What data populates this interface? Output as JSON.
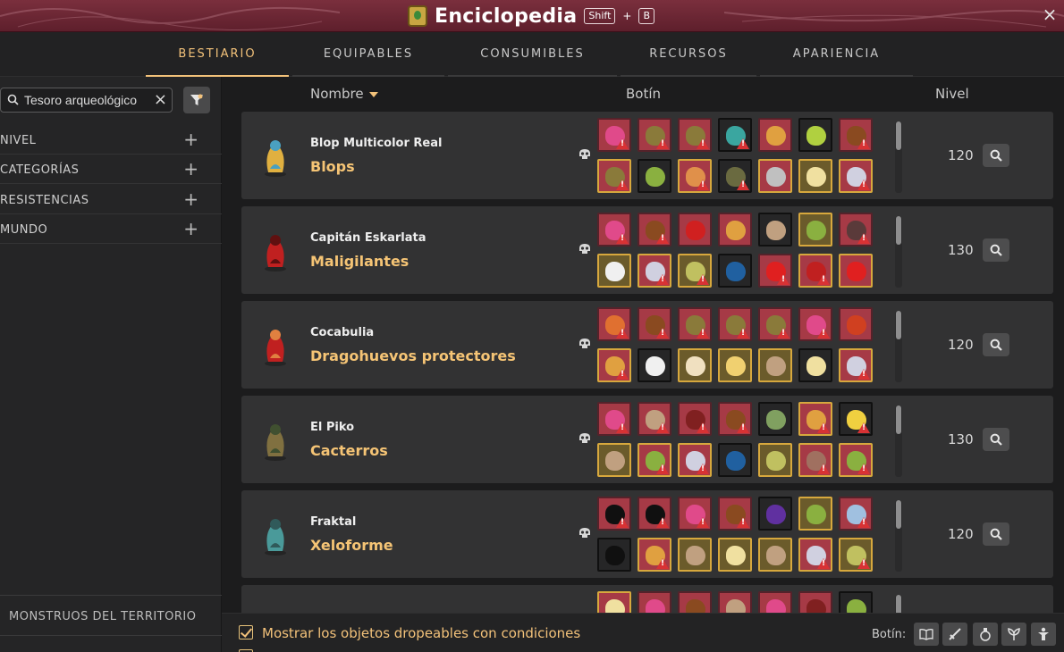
{
  "window": {
    "title": "Enciclopedia",
    "shortcut_key1": "Shift",
    "shortcut_plus": "+",
    "shortcut_key2": "B",
    "close_label": "×"
  },
  "tabs": [
    {
      "label": "BESTIARIO",
      "active": true
    },
    {
      "label": "EQUIPABLES",
      "active": false
    },
    {
      "label": "CONSUMIBLES",
      "active": false
    },
    {
      "label": "RECURSOS",
      "active": false
    },
    {
      "label": "APARIENCIA",
      "active": false
    }
  ],
  "sidebar": {
    "search_value": "Tesoro arqueológico",
    "clear_label": "×",
    "facets": [
      {
        "label": "NIVEL",
        "expand": "+"
      },
      {
        "label": "CATEGORÍAS",
        "expand": "+"
      },
      {
        "label": "RESISTENCIAS",
        "expand": "+"
      },
      {
        "label": "MUNDO",
        "expand": "+"
      }
    ],
    "monsters_territory": "MONSTRUOS DEL TERRITORIO"
  },
  "columns": {
    "name": "Nombre",
    "loot": "Botín",
    "level": "Nivel"
  },
  "rows": [
    {
      "name": "Blop Multicolor Real",
      "family": "Blops",
      "level": "120"
    },
    {
      "name": "Capitán Eskarlata",
      "family": "Maligilantes",
      "level": "130"
    },
    {
      "name": "Cocabulia",
      "family": "Dragohuevos protectores",
      "level": "120"
    },
    {
      "name": "El Piko",
      "family": "Cacterros",
      "level": "130"
    },
    {
      "name": "Fraktal",
      "family": "Xeloforme",
      "level": "120"
    }
  ],
  "bottom": {
    "show_conditional_drops": "Mostrar los objetos dropeables con condiciones",
    "botin_label": "Botín:"
  },
  "colors": {
    "accent": "#f3c27a",
    "title_bar": "#6b2734",
    "row_bg": "#323233",
    "drop_red": "#a63a46",
    "drop_gold_border": "#d7a83d"
  }
}
